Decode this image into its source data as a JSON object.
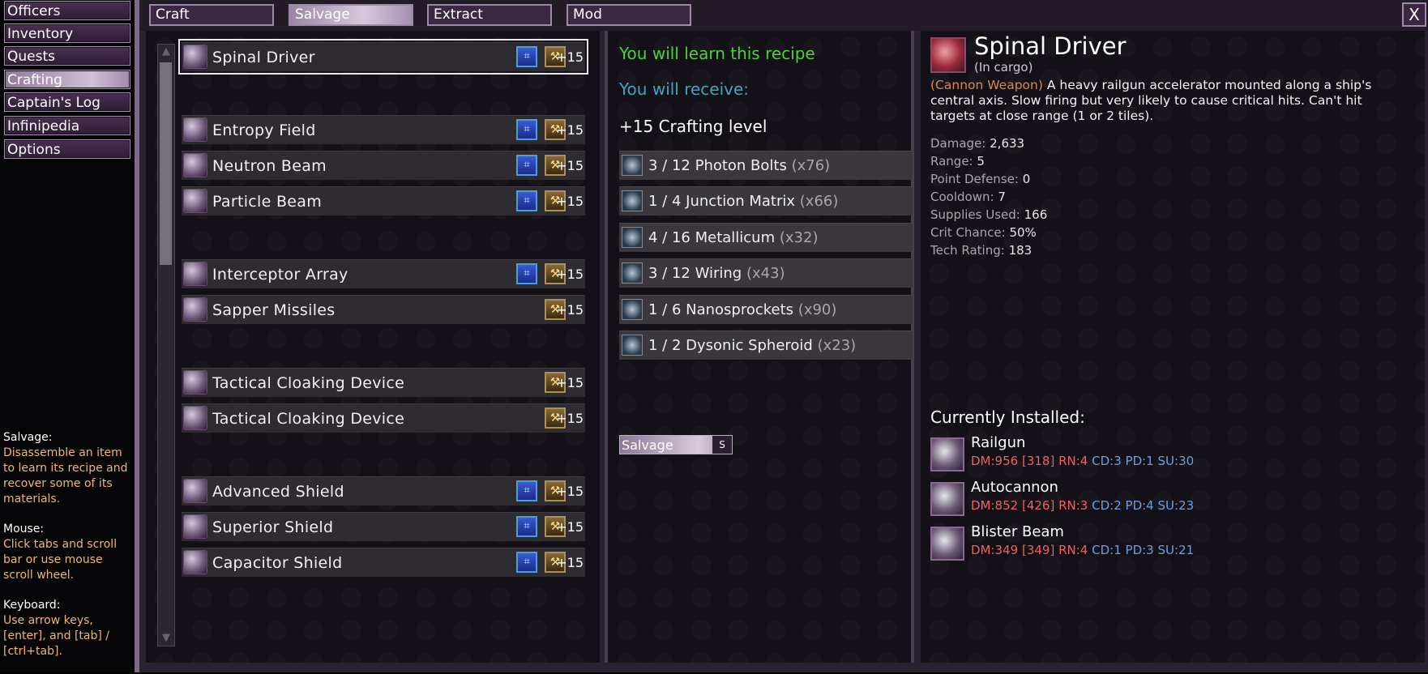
{
  "nav": {
    "items": [
      {
        "label": "Officers"
      },
      {
        "label": "Inventory"
      },
      {
        "label": "Quests"
      },
      {
        "label": "Crafting"
      },
      {
        "label": "Captain's Log"
      },
      {
        "label": "Infinipedia"
      },
      {
        "label": "Options"
      }
    ],
    "active": "Crafting"
  },
  "help": {
    "salvage_head": "Salvage:",
    "salvage_body": "Disassemble an item to learn its recipe and recover some of its materials.",
    "mouse_head": "Mouse:",
    "mouse_body": "Click tabs and scroll bar or use mouse scroll wheel.",
    "keyboard_head": "Keyboard:",
    "keyboard_body": "Use arrow keys, [enter], and [tab] / [ctrl+tab]."
  },
  "tabs": [
    {
      "label": "Craft"
    },
    {
      "label": "Salvage"
    },
    {
      "label": "Extract"
    },
    {
      "label": "Mod"
    }
  ],
  "active_tab": "Salvage",
  "close_label": "X",
  "items": [
    {
      "name": "Spinal Driver",
      "level": "+15",
      "blueprint": true
    },
    {
      "name": "Entropy Field",
      "level": "+15",
      "blueprint": true
    },
    {
      "name": "Neutron Beam",
      "level": "+15",
      "blueprint": true
    },
    {
      "name": "Particle Beam",
      "level": "+15",
      "blueprint": true
    },
    {
      "name": "Interceptor Array",
      "level": "+15",
      "blueprint": true
    },
    {
      "name": "Sapper Missiles",
      "level": "+15",
      "blueprint": false
    },
    {
      "name": "Tactical Cloaking Device",
      "level": "+15",
      "blueprint": false
    },
    {
      "name": "Tactical Cloaking Device",
      "level": "+15",
      "blueprint": false
    },
    {
      "name": "Advanced Shield",
      "level": "+15",
      "blueprint": true
    },
    {
      "name": "Superior Shield",
      "level": "+15",
      "blueprint": true
    },
    {
      "name": "Capacitor Shield",
      "level": "+15",
      "blueprint": true
    }
  ],
  "recipe": {
    "learn_text": "You will learn this recipe",
    "receive_text": "You will receive:",
    "crafting_level": "+15 Crafting level",
    "materials": [
      {
        "text": "3 / 12 Photon Bolts",
        "qty": "(x76)",
        "icon": "photon-bolts-icon"
      },
      {
        "text": "1 / 4 Junction Matrix",
        "qty": "(x66)",
        "icon": "junction-matrix-icon"
      },
      {
        "text": "4 / 16 Metallicum",
        "qty": "(x32)",
        "icon": "metallicum-icon"
      },
      {
        "text": "3 / 12 Wiring",
        "qty": "(x43)",
        "icon": "wiring-icon"
      },
      {
        "text": "1 / 6 Nanosprockets",
        "qty": "(x90)",
        "icon": "nanosprockets-icon"
      },
      {
        "text": "1 / 2 Dysonic Spheroid",
        "qty": "(x23)",
        "icon": "dysonic-spheroid-icon"
      }
    ],
    "action_label": "Salvage",
    "action_key": "S"
  },
  "detail": {
    "title": "Spinal Driver",
    "location": "(In cargo)",
    "type": "(Cannon Weapon)",
    "description": "A heavy railgun accelerator mounted along a ship's central axis. Slow firing but very likely to cause critical hits. Can't hit targets at close range (1 or 2 tiles).",
    "stats": [
      {
        "label": "Damage:",
        "value": "2,633"
      },
      {
        "label": "Range:",
        "value": "5"
      },
      {
        "label": "Point Defense:",
        "value": "0"
      },
      {
        "label": "Cooldown:",
        "value": "7"
      },
      {
        "label": "Supplies Used:",
        "value": "166"
      },
      {
        "label": "Crit Chance:",
        "value": "50%"
      },
      {
        "label": "Tech Rating:",
        "value": "183"
      }
    ],
    "installed_head": "Currently Installed:",
    "installed": [
      {
        "name": "Railgun",
        "dm": "DM:956",
        "bracket": "[318]",
        "rn": "RN:4",
        "cd": "CD:3",
        "pd": "PD:1",
        "su": "SU:30"
      },
      {
        "name": "Autocannon",
        "dm": "DM:852",
        "bracket": "[426]",
        "rn": "RN:3",
        "cd": "CD:2",
        "pd": "PD:4",
        "su": "SU:23"
      },
      {
        "name": "Blister Beam",
        "dm": "DM:349",
        "bracket": "[349]",
        "rn": "RN:4",
        "cd": "CD:1",
        "pd": "PD:3",
        "su": "SU:21"
      }
    ]
  }
}
